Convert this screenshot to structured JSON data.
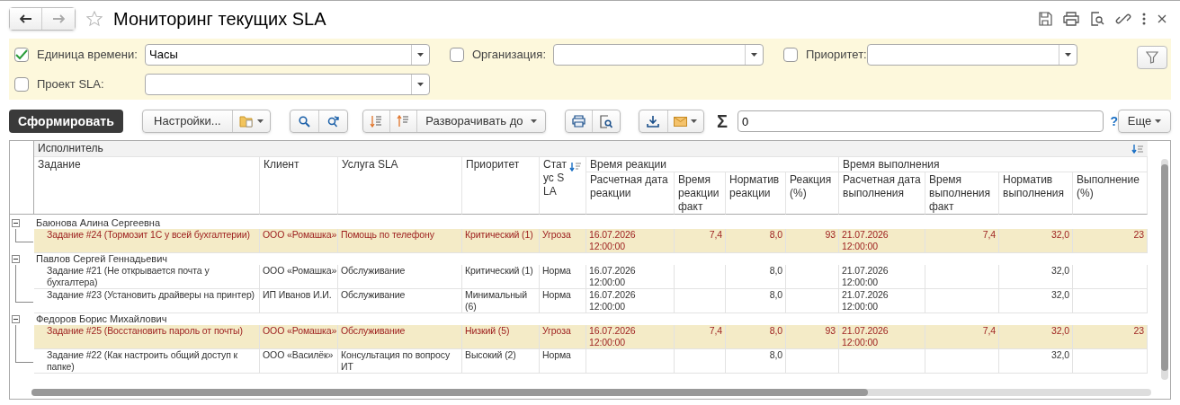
{
  "window": {
    "title": "Мониторинг текущих SLA",
    "back_enabled": true,
    "forward_enabled": false,
    "favorite": false
  },
  "filter_rows": [
    {
      "filters": [
        {
          "label": "Единица времени:",
          "checked": true,
          "value": "Часы"
        },
        {
          "label": "Организация:",
          "checked": false
        },
        {
          "label": "Приоритет:",
          "checked": false
        }
      ]
    },
    {
      "filters": [
        {
          "label": "Проект SLA:",
          "checked": false
        }
      ]
    }
  ],
  "toolbar": {
    "generate_button": "Сформировать",
    "settings_button": "Настройки...",
    "expand_button": "Разворачивать до",
    "sigma": "Σ",
    "sum_value": "0",
    "help": "?",
    "more_button": "Еще"
  },
  "table": {
    "grouping_header": "Исполнитель",
    "columns": [
      {
        "label": "Задание",
        "sorted": false
      },
      {
        "label": "Клиент",
        "sorted": false
      },
      {
        "label": "Услуга SLA",
        "sorted": false
      },
      {
        "label": "Приоритет",
        "sorted": false
      },
      {
        "label": "Статус SLA",
        "sorted": true
      },
      {
        "label": "Время реакции",
        "children": [
          {
            "label": "Расчетная дата реакции"
          },
          {
            "label": "Время реакции факт"
          },
          {
            "label": "Норматив реакции"
          },
          {
            "label": "Реакция (%)"
          }
        ]
      },
      {
        "label": "Время выполнения",
        "children": [
          {
            "label": "Расчетная дата выполнения"
          },
          {
            "label": "Время выполнения факт"
          },
          {
            "label": "Норматив выполнения"
          },
          {
            "label": "Выполнение (%)"
          }
        ]
      }
    ],
    "groups": [
      {
        "name": "Баюнова Алина Сергеевна",
        "expanded": true,
        "tasks": [
          {
            "highlighted": true,
            "task": "Задание #24 (Тормозит 1С у всей бухгалтерии)",
            "client": "ООО «Ромашка»",
            "service": "Помощь по телефону",
            "priority": "Критический (1)",
            "status": "Угроза",
            "reaction_date": "16.07.2026 12:00:00",
            "reaction_fact": "7,4",
            "reaction_norm": "8,0",
            "reaction_pct": "93",
            "completion_date": "21.07.2026 12:00:00",
            "completion_fact": "7,4",
            "completion_norm": "32,0",
            "completion_pct": "23"
          }
        ]
      },
      {
        "name": "Павлов Сергей Геннадьевич",
        "expanded": true,
        "tasks": [
          {
            "highlighted": false,
            "task": "Задание #21 (Не открывается почта у бухгалтера)",
            "client": "ООО «Ромашка»",
            "service": "Обслуживание",
            "priority": "Критический (1)",
            "status": "Норма",
            "reaction_date": "16.07.2026 12:00:00",
            "reaction_norm": "8,0",
            "completion_date": "21.07.2026 12:00:00",
            "completion_norm": "32,0"
          },
          {
            "highlighted": false,
            "task": "Задание #23 (Установить драйверы на принтер)",
            "client": "ИП Иванов И.И.",
            "service": "Обслуживание",
            "priority": "Минимальный (6)",
            "status": "Норма",
            "reaction_date": "16.07.2026 12:00:00",
            "reaction_norm": "8,0",
            "completion_date": "21.07.2026 12:00:00",
            "completion_norm": "32,0"
          }
        ]
      },
      {
        "name": "Федоров Борис Михайлович",
        "expanded": true,
        "tasks": [
          {
            "highlighted": true,
            "task": "Задание #25 (Восстановить пароль от почты)",
            "client": "ООО «Ромашка»",
            "service": "Обслуживание",
            "priority": "Низкий (5)",
            "status": "Угроза",
            "reaction_date": "16.07.2026 12:00:00",
            "reaction_fact": "7,4",
            "reaction_norm": "8,0",
            "reaction_pct": "93",
            "completion_date": "21.07.2026 12:00:00",
            "completion_fact": "7,4",
            "completion_norm": "32,0",
            "completion_pct": "23"
          },
          {
            "highlighted": false,
            "task": "Задание #22 (Как настроить общий доступ к папке)",
            "client": "ООО «Василёк»",
            "service": "Консультация по вопросу ИТ",
            "priority": "Высокий (2)",
            "status": "Норма",
            "reaction_norm": "8,0",
            "completion_norm": "32,0"
          }
        ]
      }
    ]
  }
}
